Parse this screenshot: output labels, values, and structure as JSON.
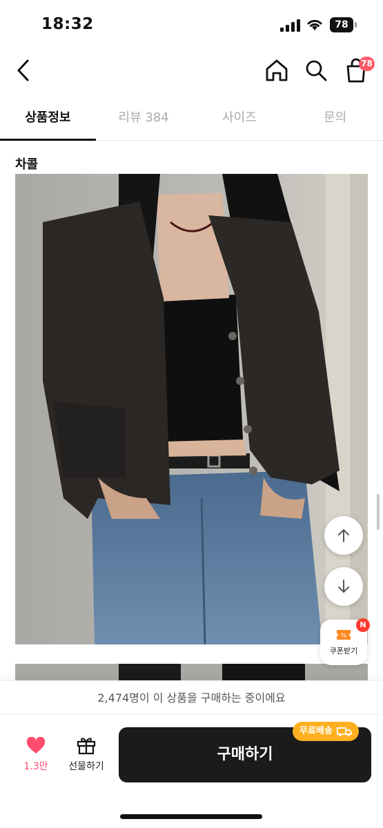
{
  "status_bar": {
    "time": "18:32",
    "battery": "78"
  },
  "header": {
    "cart_badge": "78"
  },
  "tabs": [
    {
      "label": "상품정보",
      "active": true
    },
    {
      "label": "리뷰 384",
      "active": false
    },
    {
      "label": "사이즈",
      "active": false
    },
    {
      "label": "문의",
      "active": false
    }
  ],
  "product": {
    "color_label": "차콜"
  },
  "coupon": {
    "badge": "N",
    "label": "쿠폰받기"
  },
  "buying_notice": "2,474명이 이 상품을 구매하는 중이에요",
  "bottom": {
    "like_count": "1.3만",
    "gift_label": "선물하기",
    "buy_label": "구매하기",
    "free_shipping": "무료배송"
  },
  "colors": {
    "accent": "#ff4d6d",
    "buy_button": "#1b1b1b",
    "free_shipping": "#ffb020"
  }
}
